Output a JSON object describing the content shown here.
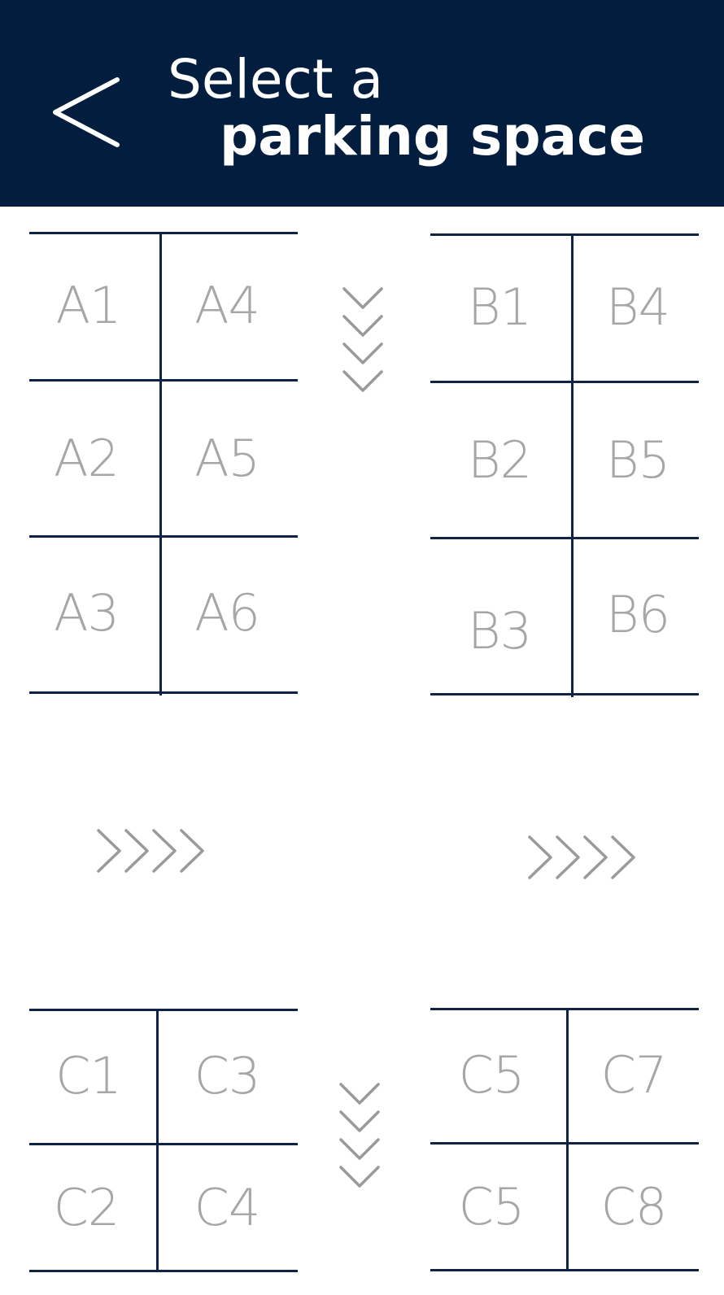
{
  "header": {
    "title_line1": "Select a",
    "title_line2": "parking space",
    "back_icon": "chevron-left-icon",
    "background": "#021d3d"
  },
  "lots": {
    "a": {
      "spaces": [
        "A1",
        "A2",
        "A3",
        "A4",
        "A5",
        "A6"
      ]
    },
    "b": {
      "spaces": [
        "B1",
        "B2",
        "B3",
        "B4",
        "B5",
        "B6"
      ]
    },
    "c_left": {
      "spaces": [
        "C1",
        "C2",
        "C3",
        "C4"
      ]
    },
    "c_right": {
      "spaces": [
        "C5",
        "C5",
        "C7",
        "C8"
      ]
    }
  },
  "icons": {
    "direction_down": "chevrons-down-icon",
    "direction_right": "chevrons-right-icon"
  },
  "colors": {
    "line": "#0f2444",
    "label": "#a6a6a6",
    "chevron": "#9a9a9a"
  }
}
